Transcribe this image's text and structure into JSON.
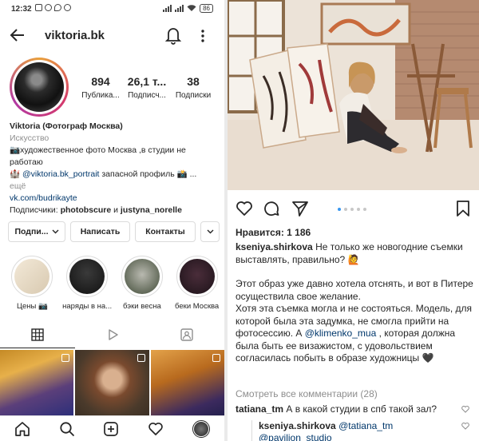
{
  "status_bar": {
    "time": "12:32",
    "battery": "86"
  },
  "profile": {
    "username": "viktoria.bk",
    "stats": [
      {
        "value": "894",
        "label": "Публика..."
      },
      {
        "value": "26,1 т...",
        "label": "Подписч..."
      },
      {
        "value": "38",
        "label": "Подписки"
      }
    ],
    "name": "Viktoria (Фотограф Москва)",
    "category": "Искусство",
    "bio_line1": "📷художественное фото Москва ,в студии не работаю",
    "bio_line2_prefix": "🏰 ",
    "bio_mention": "@viktoria.bk_portrait",
    "bio_line2_suffix": " запасной профиль 📸 ...",
    "bio_more": "ещё",
    "website": "vk.com/budrikayte",
    "followers_prefix": "Подписчики: ",
    "follower1": "photobscure",
    "followers_and": " и ",
    "follower2": "justyna_norelle"
  },
  "buttons": {
    "subscribed": "Подпи...",
    "message": "Написать",
    "contacts": "Контакты"
  },
  "highlights": [
    {
      "label": "Цены 📷"
    },
    {
      "label": "наряды в на..."
    },
    {
      "label": "бэки весна"
    },
    {
      "label": "беки Москва"
    }
  ],
  "post": {
    "likes": "Нравится: 1 186",
    "author": "kseniya.shirkova",
    "caption_first": " Не только же новогодние съемки выставлять, правильно? 🙋",
    "caption_p2": "Этот образ уже давно хотела отснять, и вот в Питере осуществила свое желание.",
    "caption_p3_a": "Хотя эта съемка могла и не состояться. Модель, для которой была эта задумка, не смогла прийти на фотосессию. А ",
    "caption_mention": "@klimenko_mua",
    "caption_p3_b": " , которая должна была быть ее визажистом, с удовольствием согласилась побыть в образе художницы 🖤",
    "view_all": "Смотреть все комментарии (28)",
    "comment1_user": "tatiana_tm",
    "comment1_text": " А в какой студии в спб такой зал?",
    "reply_user": "kseniya.shirkova",
    "reply_mention": "@tatiana_tm",
    "reply_mention2": "@pavilion_studio"
  }
}
